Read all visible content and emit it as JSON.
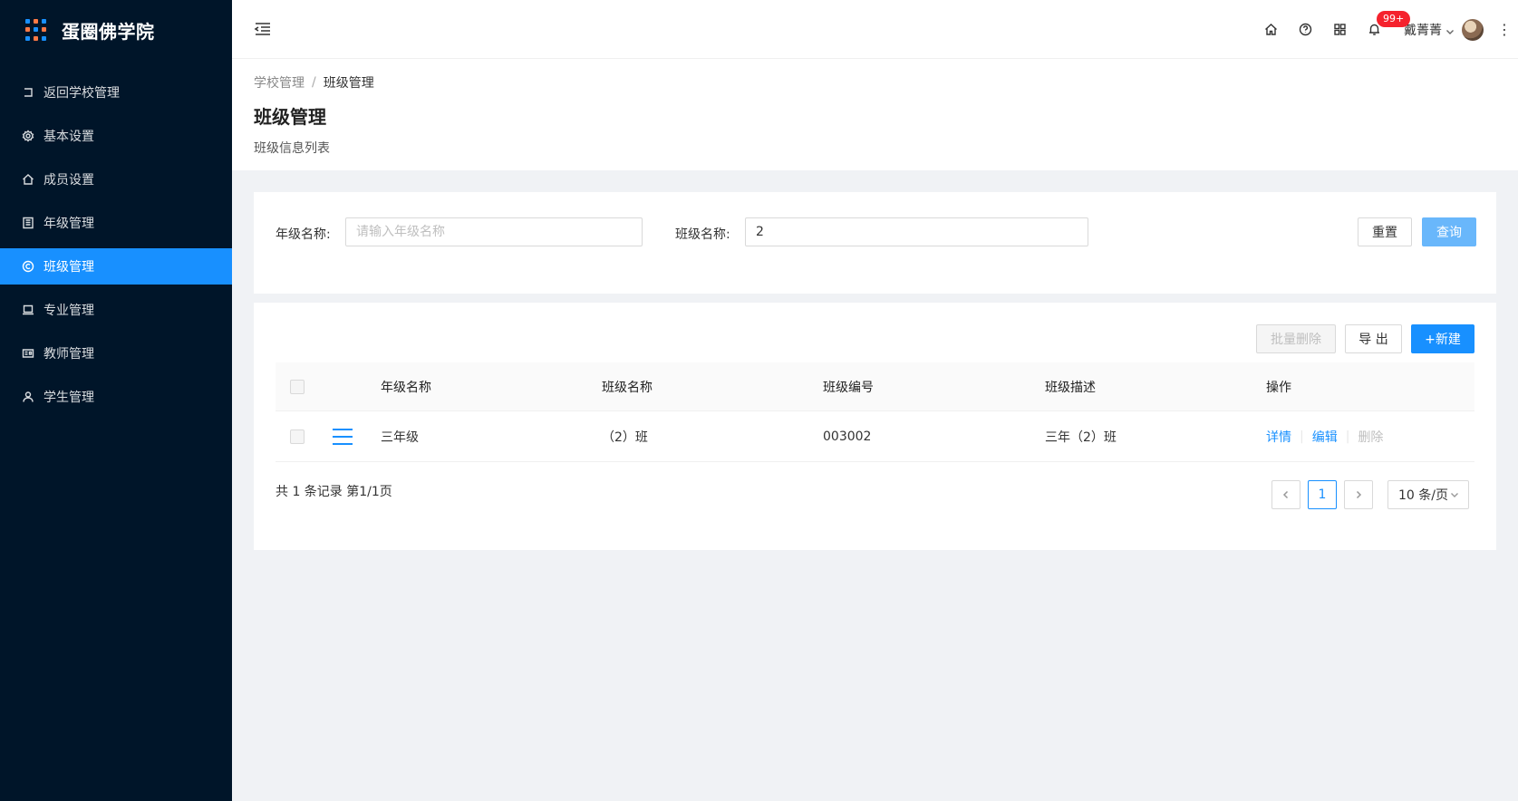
{
  "app": {
    "title": "蛋圈佛学院"
  },
  "sidebar": {
    "items": [
      {
        "label": "返回学校管理",
        "icon": "back-icon",
        "active": false
      },
      {
        "label": "基本设置",
        "icon": "gear-icon",
        "active": false
      },
      {
        "label": "成员设置",
        "icon": "home-icon",
        "active": false
      },
      {
        "label": "年级管理",
        "icon": "building-icon",
        "active": false
      },
      {
        "label": "班级管理",
        "icon": "copyright-icon",
        "active": true
      },
      {
        "label": "专业管理",
        "icon": "laptop-icon",
        "active": false
      },
      {
        "label": "教师管理",
        "icon": "id-card-icon",
        "active": false
      },
      {
        "label": "学生管理",
        "icon": "user-icon",
        "active": false
      }
    ]
  },
  "header": {
    "notification_count": "99+",
    "user_name": "戴菁菁",
    "icons": [
      "home-icon",
      "question-icon",
      "appstore-icon",
      "bell-icon"
    ]
  },
  "breadcrumb": {
    "parent": "学校管理",
    "separator": "/",
    "current": "班级管理"
  },
  "page": {
    "title": "班级管理",
    "subtitle": "班级信息列表"
  },
  "search": {
    "grade_label": "年级名称:",
    "grade_placeholder": "请输入年级名称",
    "grade_value": "",
    "class_label": "班级名称:",
    "class_value": "2",
    "reset_label": "重置",
    "query_label": "查询"
  },
  "toolbar": {
    "batch_delete_label": "批量删除",
    "export_label": "导 出",
    "new_label": "+新建"
  },
  "table": {
    "columns": [
      "年级名称",
      "班级名称",
      "班级编号",
      "班级描述",
      "操作"
    ],
    "rows": [
      {
        "grade": "三年级",
        "class_name": "（2）班",
        "class_no": "003002",
        "description": "三年（2）班",
        "actions": {
          "detail": "详情",
          "edit": "编辑",
          "delete": "删除"
        }
      }
    ]
  },
  "pagination": {
    "total_text": "共 1 条记录 第1/1页",
    "current_page": "1",
    "page_size": "10 条/页"
  },
  "colors": {
    "sidebar_bg": "#001529",
    "primary": "#1890ff",
    "badge": "#f5222d"
  }
}
